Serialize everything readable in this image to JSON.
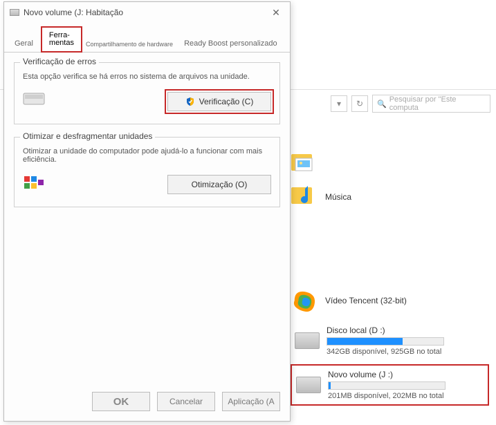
{
  "explorer": {
    "nav": {
      "dropdown_glyph": "▾",
      "refresh_glyph": "↻"
    },
    "search": {
      "icon_glyph": "🔍",
      "placeholder": "Pesquisar por \"Este computa"
    },
    "files": {
      "pictures": {
        "label": ""
      },
      "music": {
        "label": "Música"
      }
    },
    "programs": {
      "tencent": {
        "label": "Vídeo Tencent (32-bit)"
      }
    },
    "drives": {
      "d": {
        "label": "Disco local (D :)",
        "sub": "342GB disponível, 925GB no total",
        "fill_pct": 65
      },
      "j": {
        "label": "Novo volume (J :)",
        "sub": "201MB disponível, 202MB no total",
        "fill_pct": 2
      }
    }
  },
  "dialog": {
    "title": "Novo volume (J: Habitação",
    "tabs": {
      "general": "Geral",
      "tools": "Ferra-\nmentas",
      "sharing": "Compartilhamento de hardware",
      "readyboost": "Ready Boost personalizado"
    },
    "errorCheck": {
      "legend": "Verificação de erros",
      "desc": "Esta opção verifica se há erros no sistema de arquivos na unidade.",
      "button": "Verificação (C)"
    },
    "optimize": {
      "legend": "Otimizar e desfragmentar unidades",
      "desc": "Otimizar a unidade do computador pode ajudá-lo a funcionar com mais eficiência.",
      "button": "Otimização (O)"
    },
    "footer": {
      "ok": "OK",
      "cancel": "Cancelar",
      "apply": "Aplicação (A"
    }
  }
}
